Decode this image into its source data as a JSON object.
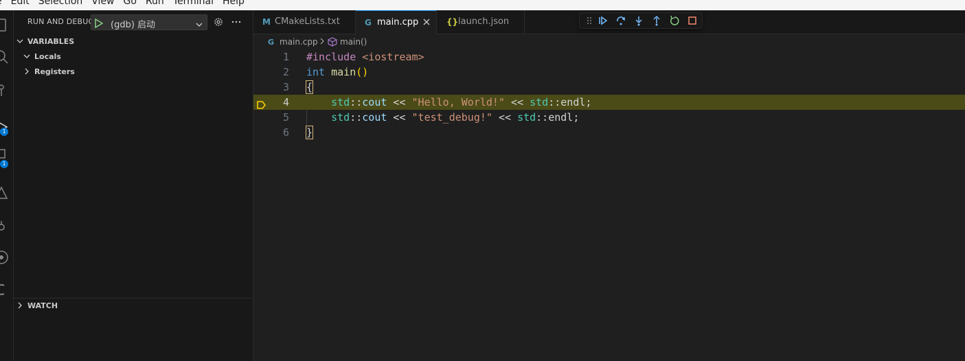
{
  "menu": [
    "e",
    "Edit",
    "Selection",
    "View",
    "Go",
    "Run",
    "Terminal",
    "Help"
  ],
  "activity_bar": {
    "badges": [
      "1",
      "1"
    ]
  },
  "sidebar": {
    "title": "RUN AND DEBUG",
    "config": "(gdb) 启动",
    "sections": {
      "variables": "VARIABLES",
      "locals": "Locals",
      "registers": "Registers",
      "watch": "WATCH"
    }
  },
  "tabs": [
    {
      "icon": "M",
      "label": "CMakeLists.txt",
      "icon_color": "#519aba"
    },
    {
      "icon": "G",
      "label": "main.cpp",
      "icon_color": "#519aba",
      "active": true
    },
    {
      "icon": "{}",
      "label": "launch.json",
      "icon_color": "#cbcb41"
    }
  ],
  "breadcrumb": {
    "file": "main.cpp",
    "symbol": "main()"
  },
  "editor": {
    "current_line": 4,
    "lines": [
      {
        "n": "1",
        "tokens": [
          [
            "pp",
            "#include"
          ],
          [
            "op",
            " "
          ],
          [
            "inc",
            "<iostream>"
          ]
        ]
      },
      {
        "n": "2",
        "tokens": [
          [
            "kw",
            "int"
          ],
          [
            "op",
            " "
          ],
          [
            "fn",
            "main"
          ],
          [
            "paren",
            "()"
          ]
        ]
      },
      {
        "n": "3",
        "tokens": [
          [
            "brace",
            "{"
          ]
        ]
      },
      {
        "n": "4",
        "tokens": [
          [
            "op",
            "    "
          ],
          [
            "ns",
            "std"
          ],
          [
            "op",
            "::"
          ],
          [
            "var",
            "cout"
          ],
          [
            "op",
            " << "
          ],
          [
            "str",
            "\"Hello, World!\""
          ],
          [
            "op",
            " << "
          ],
          [
            "ns",
            "std"
          ],
          [
            "op",
            "::"
          ],
          [
            "op",
            "endl;"
          ]
        ]
      },
      {
        "n": "5",
        "tokens": [
          [
            "op",
            "    "
          ],
          [
            "ns",
            "std"
          ],
          [
            "op",
            "::"
          ],
          [
            "var",
            "cout"
          ],
          [
            "op",
            " << "
          ],
          [
            "str",
            "\"test_debug!\""
          ],
          [
            "op",
            " << "
          ],
          [
            "ns",
            "std"
          ],
          [
            "op",
            "::"
          ],
          [
            "op",
            "endl;"
          ]
        ]
      },
      {
        "n": "6",
        "tokens": [
          [
            "brace",
            "}"
          ]
        ]
      }
    ]
  },
  "colors": {
    "accent": "#0078d4",
    "debug_blue": "#75beff",
    "debug_green": "#89d185",
    "debug_red": "#f48771",
    "current_line_bg": "#4b4b18",
    "pointer_yellow": "#ffcc00"
  }
}
